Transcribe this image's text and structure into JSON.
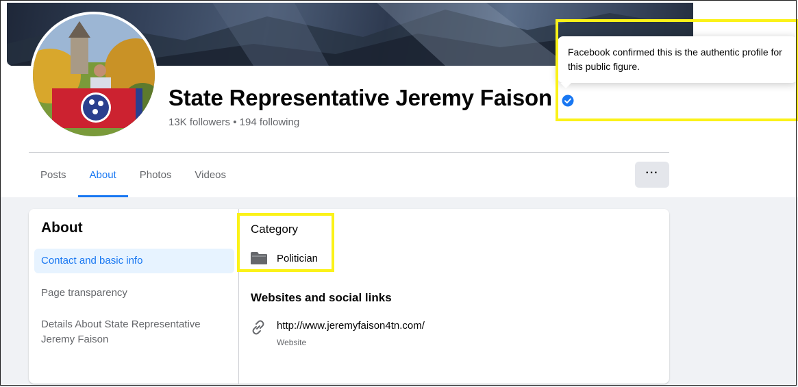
{
  "profile": {
    "name": "State Representative Jeremy Faison",
    "stats": "13K followers • 194 following"
  },
  "tooltip": {
    "text": "Facebook confirmed this is the authentic profile for this public figure."
  },
  "tabs": [
    {
      "label": "Posts"
    },
    {
      "label": "About",
      "active": true
    },
    {
      "label": "Photos"
    },
    {
      "label": "Videos"
    }
  ],
  "more_button": {
    "label": "···"
  },
  "about": {
    "heading": "About",
    "nav": [
      {
        "label": "Contact and basic info",
        "active": true
      },
      {
        "label": "Page transparency"
      },
      {
        "label": "Details About State Representative Jeremy Faison"
      }
    ],
    "category": {
      "title": "Category",
      "value": "Politician",
      "icon": "category-icon"
    },
    "websites": {
      "title": "Websites and social links",
      "url": "http://www.jeremyfaison4tn.com/",
      "url_type": "Website",
      "icon": "link-icon"
    }
  },
  "colors": {
    "accent": "#1877f2",
    "highlight": "#fbf218",
    "secondary_text": "#65676b"
  }
}
